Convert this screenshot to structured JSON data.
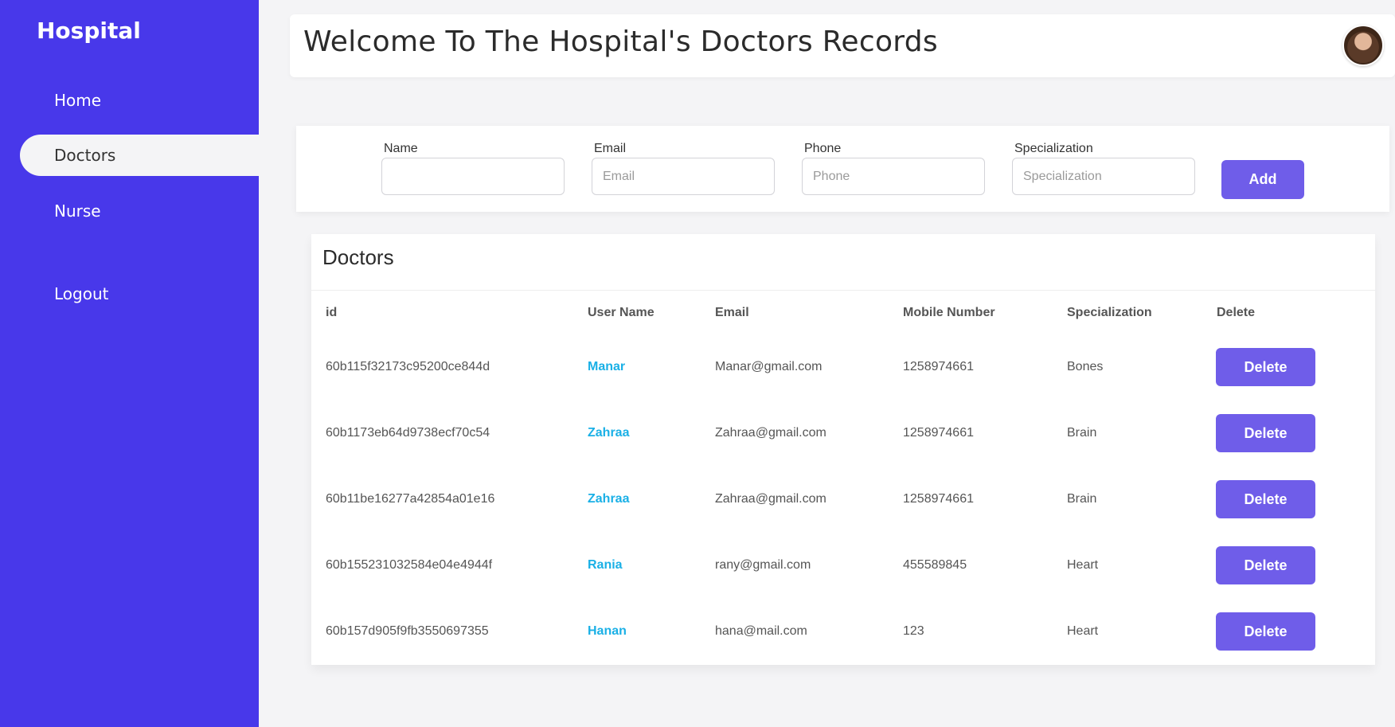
{
  "sidebar": {
    "brand": "Hospital",
    "items": [
      {
        "label": "Home",
        "active": false
      },
      {
        "label": "Doctors",
        "active": true
      },
      {
        "label": "Nurse",
        "active": false
      },
      {
        "label": "Logout",
        "active": false
      }
    ]
  },
  "header": {
    "title": "Welcome To The Hospital's Doctors Records"
  },
  "form": {
    "name": {
      "label": "Name",
      "value": "",
      "placeholder": ""
    },
    "email": {
      "label": "Email",
      "value": "",
      "placeholder": "Email"
    },
    "phone": {
      "label": "Phone",
      "value": "",
      "placeholder": "Phone"
    },
    "specialization": {
      "label": "Specialization",
      "value": "",
      "placeholder": "Specialization"
    },
    "add_label": "Add"
  },
  "table": {
    "title": "Doctors",
    "columns": [
      "id",
      "User Name",
      "Email",
      "Mobile Number",
      "Specialization",
      "Delete"
    ],
    "delete_label": "Delete",
    "rows": [
      {
        "id": "60b115f32173c95200ce844d",
        "name": "Manar",
        "email": "Manar@gmail.com",
        "mobile": "1258974661",
        "specialization": "Bones"
      },
      {
        "id": "60b1173eb64d9738ecf70c54",
        "name": "Zahraa",
        "email": "Zahraa@gmail.com",
        "mobile": "1258974661",
        "specialization": "Brain"
      },
      {
        "id": "60b11be16277a42854a01e16",
        "name": "Zahraa",
        "email": "Zahraa@gmail.com",
        "mobile": "1258974661",
        "specialization": "Brain"
      },
      {
        "id": "60b155231032584e04e4944f",
        "name": "Rania",
        "email": "rany@gmail.com",
        "mobile": "455589845",
        "specialization": "Heart"
      },
      {
        "id": "60b157d905f9fb3550697355",
        "name": "Hanan",
        "email": "hana@mail.com",
        "mobile": "123",
        "specialization": "Heart"
      }
    ]
  },
  "colors": {
    "sidebar": "#4838ea",
    "button": "#6f5de9",
    "link": "#1ab0e6",
    "background": "#f4f4f6"
  }
}
